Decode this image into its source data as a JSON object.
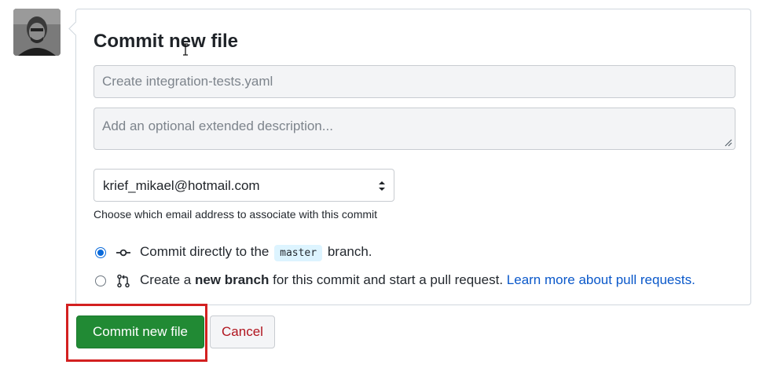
{
  "form": {
    "title": "Commit new file",
    "summary_placeholder": "Create integration-tests.yaml",
    "description_placeholder": "Add an optional extended description...",
    "email_select": {
      "selected": "krief_mikael@hotmail.com",
      "helper": "Choose which email address to associate with this commit"
    },
    "options": [
      {
        "checked": true,
        "icon": "git-commit-icon",
        "prefix": "Commit directly to the",
        "branch": "master",
        "suffix": "branch."
      },
      {
        "checked": false,
        "icon": "git-pull-request-icon",
        "prefix": "Create a",
        "bold": "new branch",
        "suffix": "for this commit and start a pull request.",
        "link": "Learn more about pull requests."
      }
    ]
  },
  "actions": {
    "commit_label": "Commit new file",
    "cancel_label": "Cancel"
  },
  "colors": {
    "primary_button": "#218a34",
    "cancel_text": "#b0141e",
    "highlight_box": "#d32020",
    "link": "#0a58ca",
    "branch_chip": "#ddf4ff"
  }
}
